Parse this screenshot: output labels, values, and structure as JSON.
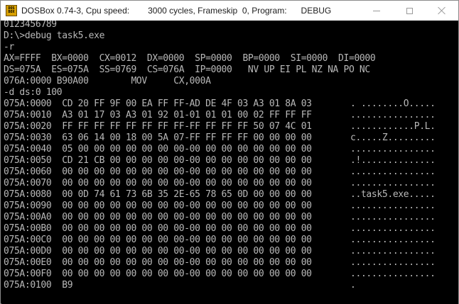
{
  "window": {
    "app_name": "DOSBox 0.74-3,",
    "cpu_speed_label": "Cpu speed:",
    "cycles_text": "3000 cycles,",
    "frameskip_text": "Frameskip  0,",
    "program_label": "Program:",
    "program_name": "DEBUG",
    "icon_text": [
      "DOS",
      "BOX"
    ]
  },
  "console": {
    "lines": [
      "0123456789",
      "D:\\>debug task5.exe",
      "-r",
      "AX=FFFF  BX=0000  CX=0012  DX=0000  SP=0000  BP=0000  SI=0000  DI=0000",
      "DS=075A  ES=075A  SS=0769  CS=076A  IP=0000   NV UP EI PL NZ NA PO NC",
      "076A:0000 B90A00        MOV     CX,000A",
      "-d ds:0 100"
    ],
    "dump": [
      {
        "left": "075A:0000  CD 20 FF 9F 00 EA FF FF-AD DE 4F 03 A3 01 8A 03",
        "ascii": ". ........O....."
      },
      {
        "left": "075A:0010  A3 01 17 03 A3 01 92 01-01 01 01 00 02 FF FF FF",
        "ascii": "................"
      },
      {
        "left": "075A:0020  FF FF FF FF FF FF FF FF-FF FF FF FF 50 07 4C 01",
        "ascii": "............P.L."
      },
      {
        "left": "075A:0030  63 06 14 00 18 00 5A 07-FF FF FF FF 00 00 00 00",
        "ascii": "c.....Z........."
      },
      {
        "left": "075A:0040  05 00 00 00 00 00 00 00-00 00 00 00 00 00 00 00",
        "ascii": "................"
      },
      {
        "left": "075A:0050  CD 21 CB 00 00 00 00 00-00 00 00 00 00 00 00 00",
        "ascii": ".!.............."
      },
      {
        "left": "075A:0060  00 00 00 00 00 00 00 00-00 00 00 00 00 00 00 00",
        "ascii": "................"
      },
      {
        "left": "075A:0070  00 00 00 00 00 00 00 00-00 00 00 00 00 00 00 00",
        "ascii": "................"
      },
      {
        "left": "075A:0080  00 0D 74 61 73 6B 35 2E-65 78 65 0D 00 00 00 00",
        "ascii": "..task5.exe....."
      },
      {
        "left": "075A:0090  00 00 00 00 00 00 00 00-00 00 00 00 00 00 00 00",
        "ascii": "................"
      },
      {
        "left": "075A:00A0  00 00 00 00 00 00 00 00-00 00 00 00 00 00 00 00",
        "ascii": "................"
      },
      {
        "left": "075A:00B0  00 00 00 00 00 00 00 00-00 00 00 00 00 00 00 00",
        "ascii": "................"
      },
      {
        "left": "075A:00C0  00 00 00 00 00 00 00 00-00 00 00 00 00 00 00 00",
        "ascii": "................"
      },
      {
        "left": "075A:00D0  00 00 00 00 00 00 00 00-00 00 00 00 00 00 00 00",
        "ascii": "................"
      },
      {
        "left": "075A:00E0  00 00 00 00 00 00 00 00-00 00 00 00 00 00 00 00",
        "ascii": "................"
      },
      {
        "left": "075A:00F0  00 00 00 00 00 00 00 00-00 00 00 00 00 00 00 00",
        "ascii": "................"
      },
      {
        "left": "075A:0100  B9",
        "ascii": "."
      }
    ]
  }
}
